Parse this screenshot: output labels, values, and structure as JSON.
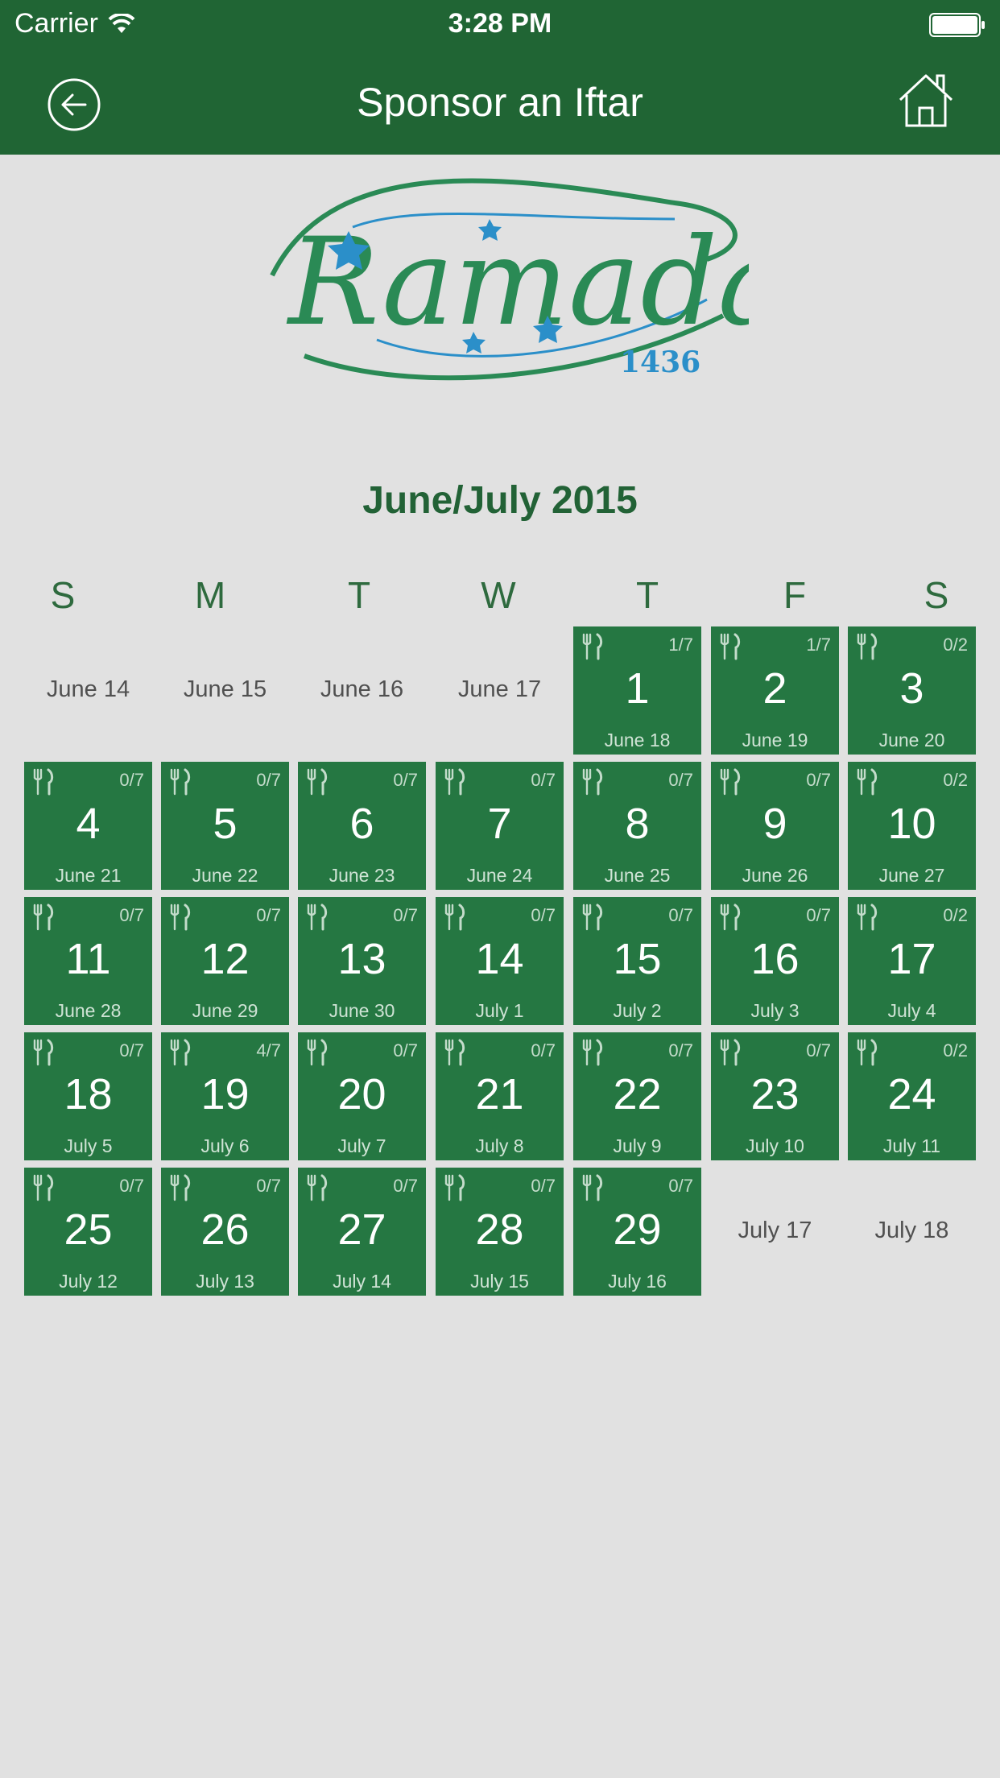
{
  "status_bar": {
    "carrier": "Carrier",
    "time": "3:28 PM"
  },
  "nav": {
    "title": "Sponsor an Iftar",
    "back_icon": "back-arrow-icon",
    "home_icon": "home-icon"
  },
  "logo": {
    "word": "Ramadan",
    "year": "1436",
    "colors": {
      "green": "#2a8a55",
      "blue": "#2b8fc9"
    }
  },
  "calendar": {
    "title": "June/July 2015",
    "weekdays": [
      "S",
      "M",
      "T",
      "W",
      "T",
      "F",
      "S"
    ],
    "leading_dates": [
      "June 14",
      "June 15",
      "June 16",
      "June 17"
    ],
    "days": [
      {
        "num": "1",
        "date": "June 18",
        "count": "1/7"
      },
      {
        "num": "2",
        "date": "June 19",
        "count": "1/7"
      },
      {
        "num": "3",
        "date": "June 20",
        "count": "0/2"
      },
      {
        "num": "4",
        "date": "June 21",
        "count": "0/7"
      },
      {
        "num": "5",
        "date": "June 22",
        "count": "0/7"
      },
      {
        "num": "6",
        "date": "June 23",
        "count": "0/7"
      },
      {
        "num": "7",
        "date": "June 24",
        "count": "0/7"
      },
      {
        "num": "8",
        "date": "June 25",
        "count": "0/7"
      },
      {
        "num": "9",
        "date": "June 26",
        "count": "0/7"
      },
      {
        "num": "10",
        "date": "June 27",
        "count": "0/2"
      },
      {
        "num": "11",
        "date": "June 28",
        "count": "0/7"
      },
      {
        "num": "12",
        "date": "June 29",
        "count": "0/7"
      },
      {
        "num": "13",
        "date": "June 30",
        "count": "0/7"
      },
      {
        "num": "14",
        "date": "July 1",
        "count": "0/7"
      },
      {
        "num": "15",
        "date": "July 2",
        "count": "0/7"
      },
      {
        "num": "16",
        "date": "July 3",
        "count": "0/7"
      },
      {
        "num": "17",
        "date": "July 4",
        "count": "0/2"
      },
      {
        "num": "18",
        "date": "July 5",
        "count": "0/7"
      },
      {
        "num": "19",
        "date": "July 6",
        "count": "4/7"
      },
      {
        "num": "20",
        "date": "July 7",
        "count": "0/7"
      },
      {
        "num": "21",
        "date": "July 8",
        "count": "0/7"
      },
      {
        "num": "22",
        "date": "July 9",
        "count": "0/7"
      },
      {
        "num": "23",
        "date": "July 10",
        "count": "0/7"
      },
      {
        "num": "24",
        "date": "July 11",
        "count": "0/2"
      },
      {
        "num": "25",
        "date": "July 12",
        "count": "0/7"
      },
      {
        "num": "26",
        "date": "July 13",
        "count": "0/7"
      },
      {
        "num": "27",
        "date": "July 14",
        "count": "0/7"
      },
      {
        "num": "28",
        "date": "July 15",
        "count": "0/7"
      },
      {
        "num": "29",
        "date": "July 16",
        "count": "0/7"
      }
    ],
    "trailing_dates": [
      "July 17",
      "July 18"
    ],
    "colors": {
      "cell": "#257742",
      "header": "#206534",
      "background": "#e1e1e1"
    }
  }
}
